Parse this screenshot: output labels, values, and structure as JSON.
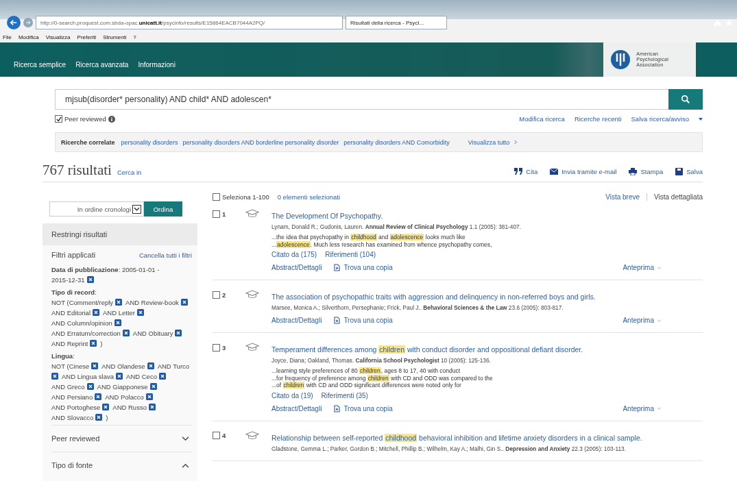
{
  "browser": {
    "url_prefix": "http://0-search.proquest.com.sbda-opac.",
    "url_domain": "unicatt.it",
    "url_rest": "/psycinfo/results/E15864EACB7044A2PQ/",
    "tab_title": "Risultati della ricerca - PsycI...",
    "menu": [
      "File",
      "Modifica",
      "Visualizza",
      "Preferiti",
      "Strumenti",
      "?"
    ]
  },
  "nav": [
    "Ricerca semplice",
    "Ricerca avanzata",
    "Informazioni"
  ],
  "publisher": [
    "American",
    "Psychological",
    "Association"
  ],
  "search": {
    "value": "mjsub(disorder* personality) AND child* AND adolescen*"
  },
  "peer_reviewed": {
    "label": "Peer reviewed",
    "checked": true
  },
  "search_links": [
    "Modifica ricerca",
    "Ricerche recenti",
    "Salva ricerca/avviso"
  ],
  "related": {
    "label": "Ricerche correlate",
    "items": [
      "personality disorders",
      "personality disorders AND borderline personality disorder",
      "personality disorders AND Comorbidity"
    ],
    "more": "Visualizza tutto"
  },
  "results_header": {
    "count": "767 risultati",
    "search_in": "Cerca in",
    "actions": [
      {
        "kind": "quote",
        "label": "Cita"
      },
      {
        "kind": "mail",
        "label": "Invia tramite e-mail"
      },
      {
        "kind": "print",
        "label": "Stampa"
      },
      {
        "kind": "save",
        "label": "Salva"
      }
    ]
  },
  "sort": {
    "value": "In ordine cronologi",
    "button": "Ordina"
  },
  "narrow": {
    "title": "Restringi risultati",
    "applied": "Filtri applicati",
    "clear": "Cancella tutti i filtri",
    "groups": [
      {
        "label": "**Data di pubblicazione**: 2005-01-01 -",
        "items": [
          "2015-12-31"
        ]
      },
      {
        "label": "**Tipo di record**:",
        "items": [
          "NOT (Comment/reply",
          "AND Review-book",
          "AND Editorial",
          "AND Letter",
          "AND Column/opinion",
          "AND Erratum/correction",
          "AND Obituary",
          "AND Reprint"
        ],
        "suffix": ")"
      },
      {
        "label": "**Lingua**:",
        "items": [
          "NOT (Cinese",
          "AND Olandese",
          "AND Turco",
          "AND Lingua slava",
          "AND Ceco",
          "AND Greco",
          "AND Giapponese",
          "AND Persiano",
          "AND Polacco",
          "AND Portoghese",
          "AND Russo",
          "AND Slovacco"
        ],
        "suffix": ")"
      }
    ],
    "sections": [
      {
        "label": "Peer reviewed",
        "expanded": false
      },
      {
        "label": "Tipo di fonte",
        "expanded": true
      }
    ]
  },
  "selection": {
    "select_all": "Seleziona 1-100",
    "checked": false,
    "selected_count": "0 elementi selezionati"
  },
  "views": [
    {
      "label": "Vista breve",
      "selected": false
    },
    {
      "label": "Vista dettagliata",
      "selected": true
    }
  ],
  "results": [
    {
      "number": "1",
      "checked": false,
      "title": [
        {
          "text": "The Development Of Psychopathy.",
          "highlight": false
        }
      ],
      "citation": "Lynam, Donald R.; Gudonis, Lauren. **Annual Review of Clinical Psychology** 1.1  (2005): 381-407.",
      "snippet": [
        [
          {
            "text": "...the idea that psychopathy in ",
            "highlight": false
          },
          {
            "text": "childhood",
            "highlight": true
          },
          {
            "text": " and ",
            "highlight": false
          },
          {
            "text": "adolescence",
            "highlight": true
          },
          {
            "text": " looks much like",
            "highlight": false
          }
        ],
        [
          {
            "text": "...",
            "highlight": false
          },
          {
            "text": "adolescence",
            "highlight": true
          },
          {
            "text": ". Much less research has examined from whence psychopathy comes,",
            "highlight": false
          }
        ]
      ],
      "cited_by": "Citato da (175)",
      "references": "Riferimenti (104)",
      "abstract": "Abstract/Dettagli",
      "find_copy": "Trova una copia",
      "preview": "Anteprima"
    },
    {
      "number": "2",
      "checked": false,
      "title": [
        {
          "text": "The association of psychopathic traits with aggression and delinquency in non-referred boys and girls.",
          "highlight": false
        }
      ],
      "citation": "Marsee, Monica A.; Silverthorn, Persephanie; Frick, Paul J.. **Behavioral Sciences & the Law** 23.6  (2005): 803-817.",
      "abstract": "Abstract/Dettagli",
      "find_copy": "Trova una copia",
      "preview": "Anteprima"
    },
    {
      "number": "3",
      "checked": false,
      "title": [
        {
          "text": "Temperament differences among ",
          "highlight": false
        },
        {
          "text": "children",
          "highlight": true
        },
        {
          "text": " with conduct disorder and oppositional defiant disorder.",
          "highlight": false
        }
      ],
      "citation": "Joyce, Diana; Oakland, Thomas. **California School Psychologist** 10  (2005): 125-136.",
      "snippet": [
        [
          {
            "text": "...learning style preferences of 80 ",
            "highlight": false
          },
          {
            "text": "children",
            "highlight": true
          },
          {
            "text": ", ages 8 to 17, 40 with conduct",
            "highlight": false
          }
        ],
        [
          {
            "text": "...for frequency of preference among ",
            "highlight": false
          },
          {
            "text": "children",
            "highlight": true
          },
          {
            "text": " with CD and ODD was compared to the",
            "highlight": false
          }
        ],
        [
          {
            "text": "...of ",
            "highlight": false
          },
          {
            "text": "children",
            "highlight": true
          },
          {
            "text": " with CD and ODD significant differences were noted only for",
            "highlight": false
          }
        ]
      ],
      "cited_by": "Citato da (19)",
      "references": "Riferimenti (35)",
      "abstract": "Abstract/Dettagli",
      "find_copy": "Trova una copia",
      "preview": "Anteprima"
    },
    {
      "number": "4",
      "checked": false,
      "title": [
        {
          "text": "Relationship between self-reported ",
          "highlight": false
        },
        {
          "text": "childhood",
          "highlight": true
        },
        {
          "text": " behavioral inhibition and lifetime anxiety disorders in a clinical sample.",
          "highlight": false
        }
      ],
      "citation": "Gladstone, Gemma L.; Parker, Gordon B.; Mitchell, Phillip B.; Wilhelm, Kay A.; Malhi, Gin S.. **Depression and Anxiety** 22.3  (2005): 103-113."
    }
  ]
}
